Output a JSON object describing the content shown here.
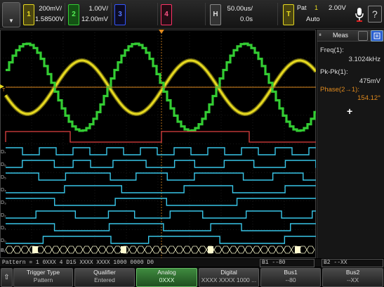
{
  "topbar": {
    "ch1": {
      "num": "1",
      "scale": "200mV/",
      "offset": "1.58500V",
      "color": "#e6d920"
    },
    "ch2": {
      "num": "2",
      "scale": "1.00V/",
      "offset": "12.00mV",
      "color": "#33cc33"
    },
    "ch3": {
      "num": "3",
      "color": "#3355ff"
    },
    "ch4": {
      "num": "4",
      "color": "#ff3366"
    },
    "horiz": {
      "label": "H",
      "timebase": "50.00us/",
      "delay": "0.0s"
    },
    "trigger": {
      "label": "T",
      "type": "Pat",
      "source": "1",
      "level": "2.00V",
      "mode": "Auto"
    }
  },
  "side": {
    "title": "Meas",
    "measurements": [
      {
        "label": "Freq(1):",
        "value": "3.1024kHz"
      },
      {
        "label": "Pk-Pk(1):",
        "value": "475mV"
      },
      {
        "label": "Phase(2→1):",
        "value": "154.12°"
      }
    ],
    "add": "+"
  },
  "digital_labels": [
    "D₇",
    "D₆",
    "D₅",
    "D₄",
    "D₃",
    "D₂",
    "D₁",
    "D₀"
  ],
  "bus_label": "B₁",
  "pattern_bar": {
    "text": "Pattern = 1 0XXX 4 D15 XXXX XXXX 1000 0000 D0",
    "bus1": "B1 --80",
    "bus2": "B2 --XX"
  },
  "softkeys": [
    {
      "title": "Trigger Type",
      "value": "Pattern"
    },
    {
      "title": "Qualifier",
      "value": "Entered"
    },
    {
      "title": "Analog",
      "value": "0XXX"
    },
    {
      "title": "Digital",
      "value": "XXXX XXXX 1000 ..."
    },
    {
      "title": "Bus1",
      "value": "--80"
    },
    {
      "title": "Bus2",
      "value": "--XX"
    }
  ],
  "colors": {
    "sine": "#e6d920",
    "square": "#33cc33",
    "digital": "#39c6e8",
    "trigger_level": "#e08a1e",
    "bus": "#f2f2c8"
  }
}
